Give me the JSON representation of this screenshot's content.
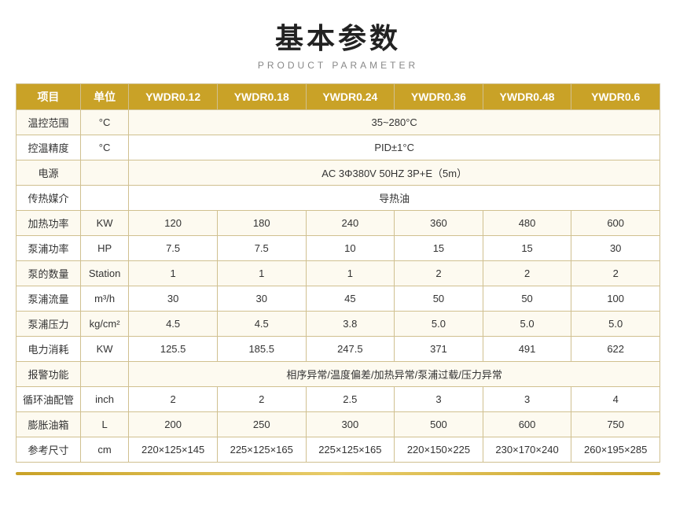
{
  "header": {
    "title": "基本参数",
    "subtitle": "PRODUCT PARAMETER"
  },
  "table": {
    "columns": [
      {
        "key": "item",
        "label": "项目"
      },
      {
        "key": "unit",
        "label": "单位"
      },
      {
        "key": "m1",
        "label": "YWDR0.12"
      },
      {
        "key": "m2",
        "label": "YWDR0.18"
      },
      {
        "key": "m3",
        "label": "YWDR0.24"
      },
      {
        "key": "m4",
        "label": "YWDR0.36"
      },
      {
        "key": "m5",
        "label": "YWDR0.48"
      },
      {
        "key": "m6",
        "label": "YWDR0.6"
      }
    ],
    "rows": [
      {
        "item": "温控范围",
        "unit": "°C",
        "span": "35~280°C"
      },
      {
        "item": "控温精度",
        "unit": "°C",
        "span": "PID±1°C"
      },
      {
        "item": "电源",
        "unit": "",
        "span": "AC 3Φ380V 50HZ 3P+E（5m）"
      },
      {
        "item": "传热媒介",
        "unit": "",
        "span": "导热油"
      },
      {
        "item": "加热功率",
        "unit": "KW",
        "m1": "120",
        "m2": "180",
        "m3": "240",
        "m4": "360",
        "m5": "480",
        "m6": "600"
      },
      {
        "item": "泵浦功率",
        "unit": "HP",
        "m1": "7.5",
        "m2": "7.5",
        "m3": "10",
        "m4": "15",
        "m5": "15",
        "m6": "30"
      },
      {
        "item": "泵的数量",
        "unit": "Station",
        "m1": "1",
        "m2": "1",
        "m3": "1",
        "m4": "2",
        "m5": "2",
        "m6": "2"
      },
      {
        "item": "泵浦流量",
        "unit": "m³/h",
        "m1": "30",
        "m2": "30",
        "m3": "45",
        "m4": "50",
        "m5": "50",
        "m6": "100"
      },
      {
        "item": "泵浦压力",
        "unit": "kg/cm²",
        "m1": "4.5",
        "m2": "4.5",
        "m3": "3.8",
        "m4": "5.0",
        "m5": "5.0",
        "m6": "5.0"
      },
      {
        "item": "电力消耗",
        "unit": "KW",
        "m1": "125.5",
        "m2": "185.5",
        "m3": "247.5",
        "m4": "371",
        "m5": "491",
        "m6": "622"
      },
      {
        "item": "报警功能",
        "unit": "",
        "span": "相序异常/温度偏差/加热异常/泵浦过载/压力异常"
      },
      {
        "item": "循环油配管",
        "unit": "inch",
        "m1": "2",
        "m2": "2",
        "m3": "2.5",
        "m4": "3",
        "m5": "3",
        "m6": "4"
      },
      {
        "item": "膨胀油箱",
        "unit": "L",
        "m1": "200",
        "m2": "250",
        "m3": "300",
        "m4": "500",
        "m5": "600",
        "m6": "750"
      },
      {
        "item": "参考尺寸",
        "unit": "cm",
        "m1": "220×125×145",
        "m2": "225×125×165",
        "m3": "225×125×165",
        "m4": "220×150×225",
        "m5": "230×170×240",
        "m6": "260×195×285"
      }
    ]
  }
}
